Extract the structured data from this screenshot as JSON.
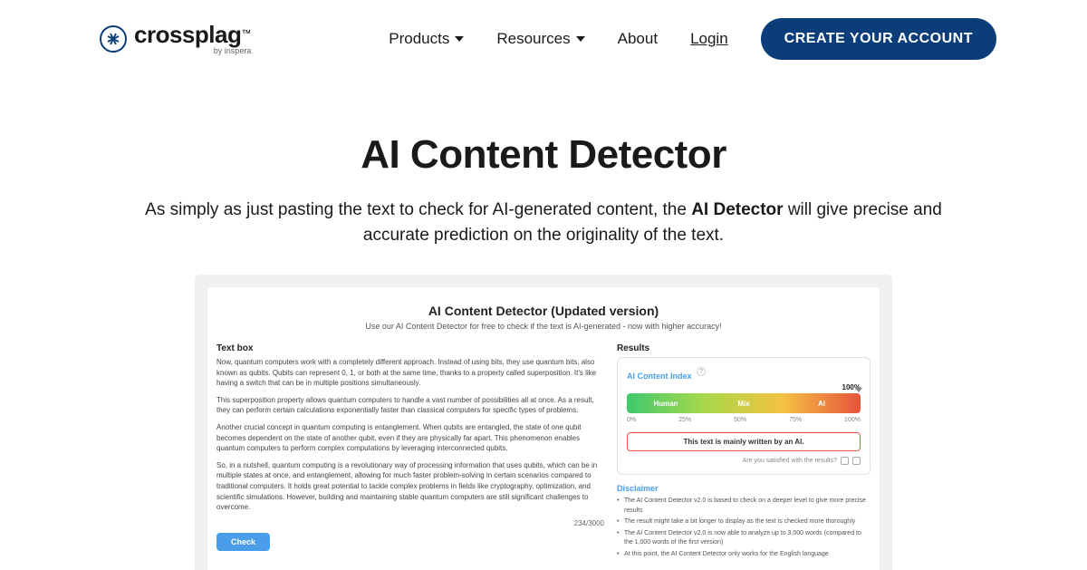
{
  "brand": {
    "name": "crossplag",
    "tm": "™",
    "byline": "by inspera"
  },
  "nav": {
    "products": "Products",
    "resources": "Resources",
    "about": "About",
    "login": "Login",
    "cta": "CREATE YOUR ACCOUNT"
  },
  "hero": {
    "title": "AI Content Detector",
    "sub_prefix": "As simply as just pasting the text to check for AI-generated content, the ",
    "sub_strong": "AI Detector",
    "sub_suffix": " will give precise and accurate prediction on the originality of the text."
  },
  "detector": {
    "title": "AI Content Detector (Updated version)",
    "subtitle": "Use our AI Content Detector for free to check if the text is AI-generated - now with higher accuracy!",
    "textbox_label": "Text box",
    "results_label": "Results",
    "paragraphs": [
      "Now, quantum computers work with a completely different approach. Instead of using bits, they use quantum bits, also known as qubits. Qubits can represent 0, 1, or both at the same time, thanks to a property called superposition. It's like having a switch that can be in multiple positions simultaneously.",
      "This superposition property allows quantum computers to handle a vast number of possibilities all at once. As a result, they can perform certain calculations exponentially faster than classical computers for specific types of problems.",
      "Another crucial concept in quantum computing is entanglement. When qubits are entangled, the state of one qubit becomes dependent on the state of another qubit, even if they are physically far apart. This phenomenon enables quantum computers to perform complex computations by leveraging interconnected qubits.",
      "So, in a nutshell, quantum computing is a revolutionary way of processing information that uses qubits, which can be in multiple states at once, and entanglement, allowing for much faster problem-solving in certain scenarios compared to traditional computers. It holds great potential to tackle complex problems in fields like cryptography, optimization, and scientific simulations. However, building and maintaining stable quantum computers are still significant challenges to overcome."
    ],
    "word_count": "234/3000",
    "check": "Check",
    "aci_label": "AI Content Index",
    "percent": "100%",
    "seg_human": "Human",
    "seg_mix": "Mix",
    "seg_ai": "AI",
    "ticks": [
      "0%",
      "25%",
      "50%",
      "75%",
      "100%"
    ],
    "verdict": "This text is mainly written by an AI.",
    "satisfied": "Are you satisfied with the results?",
    "disclaimer_title": "Disclaimer",
    "disclaimers": [
      "The AI Content Detector v2.0 is based to check on a deeper level to give more precise results",
      "The result might take a bit longer to display as the text is checked more thoroughly",
      "The AI Content Detector v2.0 is now able to analyze up to 3,000 words (compared to the 1,000 words of the first version)",
      "At this point, the AI Content Detector only works for the English language"
    ]
  }
}
